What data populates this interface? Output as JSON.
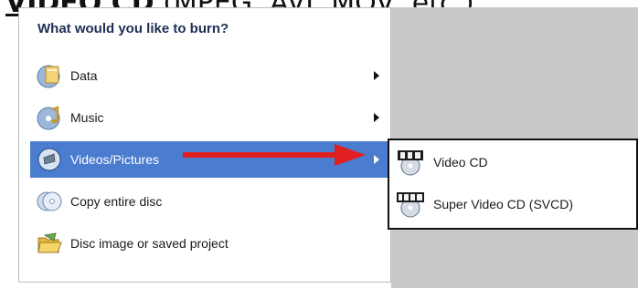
{
  "caption": {
    "prefix": "VIDEO CD",
    "suffix": " (MPEG, AVI, MOV, etc.)"
  },
  "menu": {
    "title": "What would you like to burn?",
    "items": [
      {
        "label": "Data",
        "icon": "data-folder-icon",
        "has_submenu": true
      },
      {
        "label": "Music",
        "icon": "music-note-icon",
        "has_submenu": true
      },
      {
        "label": "Videos/Pictures",
        "icon": "video-disc-icon",
        "has_submenu": true,
        "selected": true
      },
      {
        "label": "Copy entire disc",
        "icon": "copy-disc-icon",
        "has_submenu": false
      },
      {
        "label": "Disc image or saved project",
        "icon": "open-folder-icon",
        "has_submenu": false
      }
    ]
  },
  "submenu": {
    "items": [
      {
        "label": "Video CD",
        "icon": "vcd-icon"
      },
      {
        "label": "Super Video CD (SVCD)",
        "icon": "svcd-icon"
      }
    ]
  },
  "colors": {
    "selection": "#4a7cd0",
    "pointer_arrow": "#e02020",
    "background_gray": "#c9c9c9"
  }
}
